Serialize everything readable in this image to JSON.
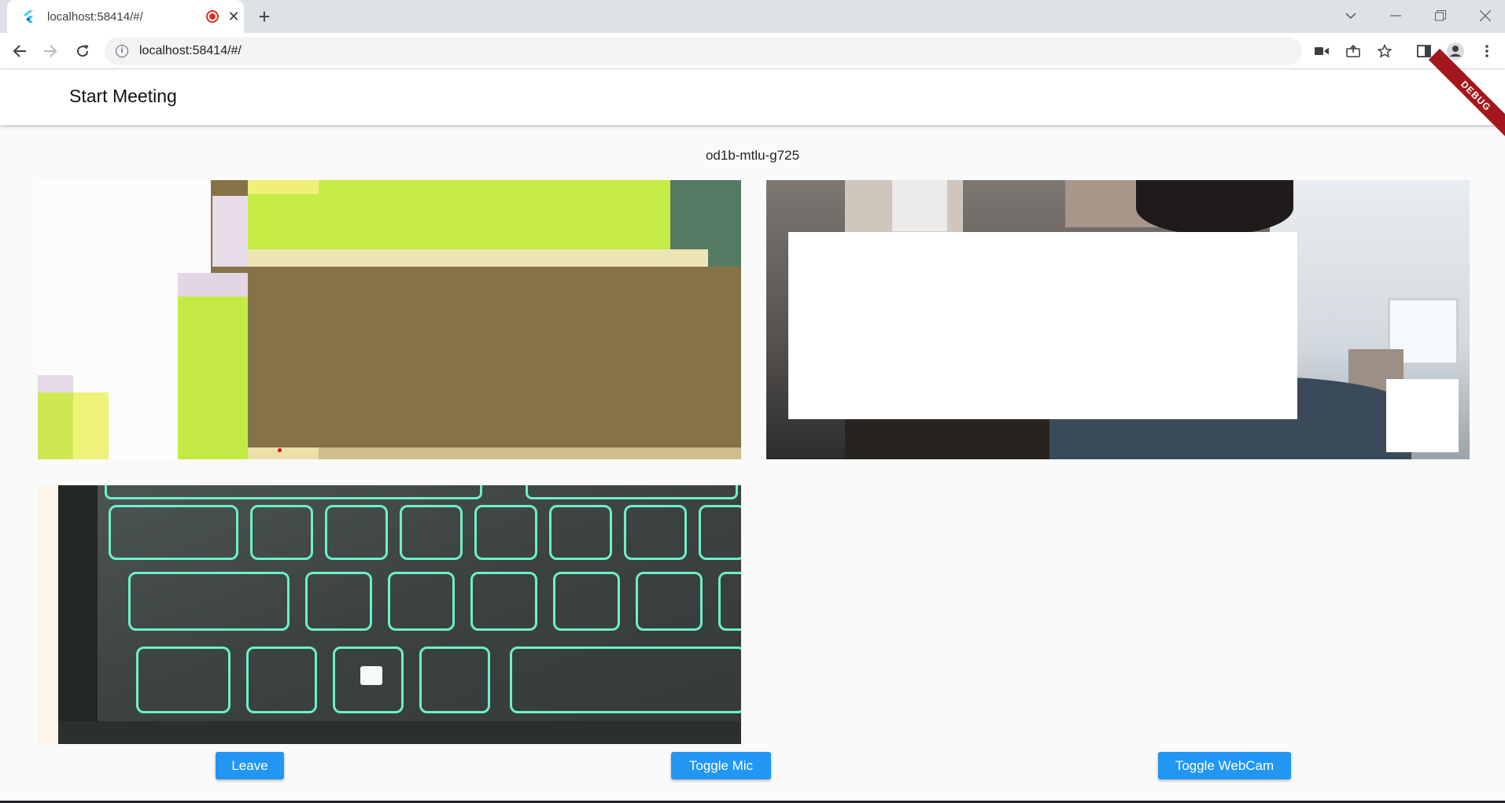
{
  "browser": {
    "tab_title": "localhost:58414/#/",
    "close_glyph": "✕",
    "new_tab_glyph": "+",
    "url": "localhost:58414/#/"
  },
  "app": {
    "title": "Start Meeting",
    "debug_banner": "DEBUG",
    "meeting_id": "od1b-mtlu-g725"
  },
  "participants": [
    {
      "type": "screen-share"
    },
    {
      "type": "webcam"
    },
    {
      "type": "webcam-keyboard"
    }
  ],
  "controls": {
    "leave": "Leave",
    "toggle_mic": "Toggle Mic",
    "toggle_webcam": "Toggle WebCam"
  },
  "colors": {
    "accent": "#2196f3",
    "debug": "#a3171d",
    "recording": "#d93025",
    "keyboard_glow": "#6cf0c8"
  }
}
